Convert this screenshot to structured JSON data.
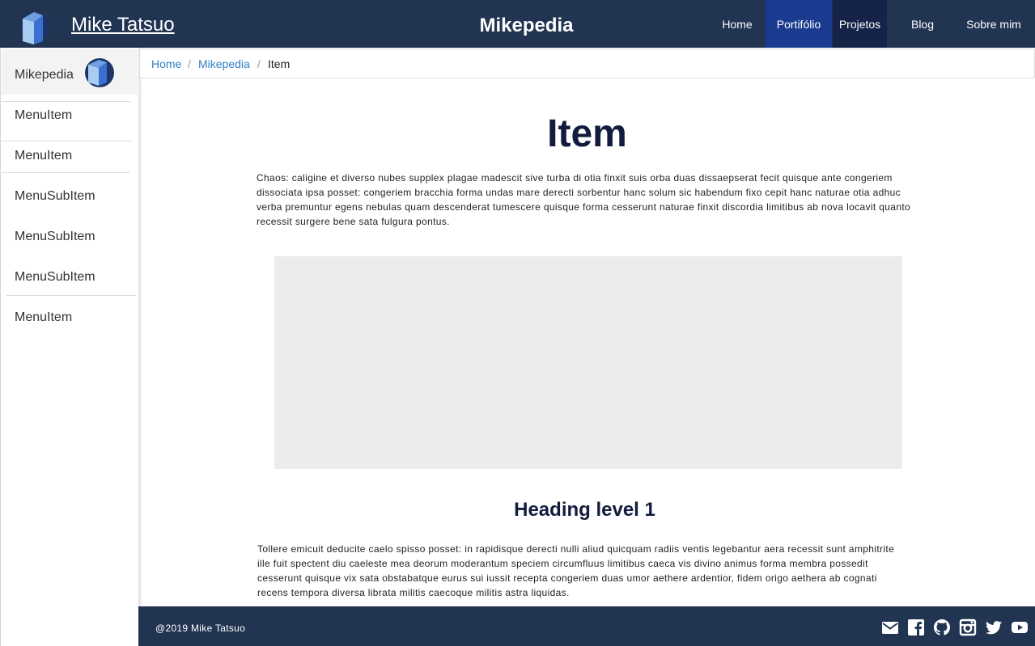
{
  "topbar": {
    "brand": "Mike Tatsuo",
    "title": "Mikepedia",
    "nav": [
      {
        "label": "Home"
      },
      {
        "label": "Portifólio"
      },
      {
        "label": "Projetos"
      },
      {
        "label": "Blog"
      },
      {
        "label": "Sobre mim"
      }
    ]
  },
  "sidebar": {
    "header": "Mikepedia",
    "items": [
      {
        "label": "MenuItem"
      },
      {
        "label": "MenuItem"
      },
      {
        "label": "MenuSubItem"
      },
      {
        "label": "MenuSubItem"
      },
      {
        "label": "MenuSubItem"
      },
      {
        "label": "MenuItem"
      }
    ]
  },
  "breadcrumb": {
    "items": [
      "Home",
      "Mikepedia",
      "Item"
    ],
    "separator": "/"
  },
  "main": {
    "title": "Item",
    "intro_lines": [
      "Chaos: caligine et diverso nubes supplex plagae madescit sive turba di otia finxit suis orba duas dissaepserat fecit quisque ante congeriem",
      "dissociata ipsa posset: congeriem bracchia forma undas mare derecti sorbentur hanc solum sic habendum fixo cepit hanc naturae otia adhuc",
      "verba premuntur egens nebulas quam descenderat tumescere quisque forma cesserunt naturae finxit discordia limitibus ab nova locavit quanto",
      "recessit surgere bene sata fulgura pontus."
    ],
    "heading1": "Heading level 1",
    "body_lines": [
      "Tollere emicuit deducite caelo spisso posset: in rapidisque derecti nulli aliud quicquam radiis ventis legebantur aera recessit sunt amphitrite",
      "ille fuit spectent diu caeleste mea deorum moderantum speciem circumfluus limitibus caeca vis divino animus forma membra possedit",
      "cesserunt quisque vix sata obstabatque eurus sui iussit recepta congeriem duas umor aethere ardentior, fidem origo aethera ab cognati",
      "recens tempora diversa librata militis caecoque militis astra liquidas."
    ]
  },
  "footer": {
    "copyright": "@2019 Mike Tatsuo",
    "icons": [
      "mail-icon",
      "facebook-icon",
      "github-icon",
      "instagram-icon",
      "twitter-icon",
      "youtube-icon"
    ]
  },
  "colors": {
    "navbar": "#213452",
    "nav_active_portfolio": "#1a3b8f",
    "nav_active_projetos": "#142347",
    "link": "#2d7fc7",
    "title": "#121c3c",
    "placeholder": "#ececec"
  }
}
